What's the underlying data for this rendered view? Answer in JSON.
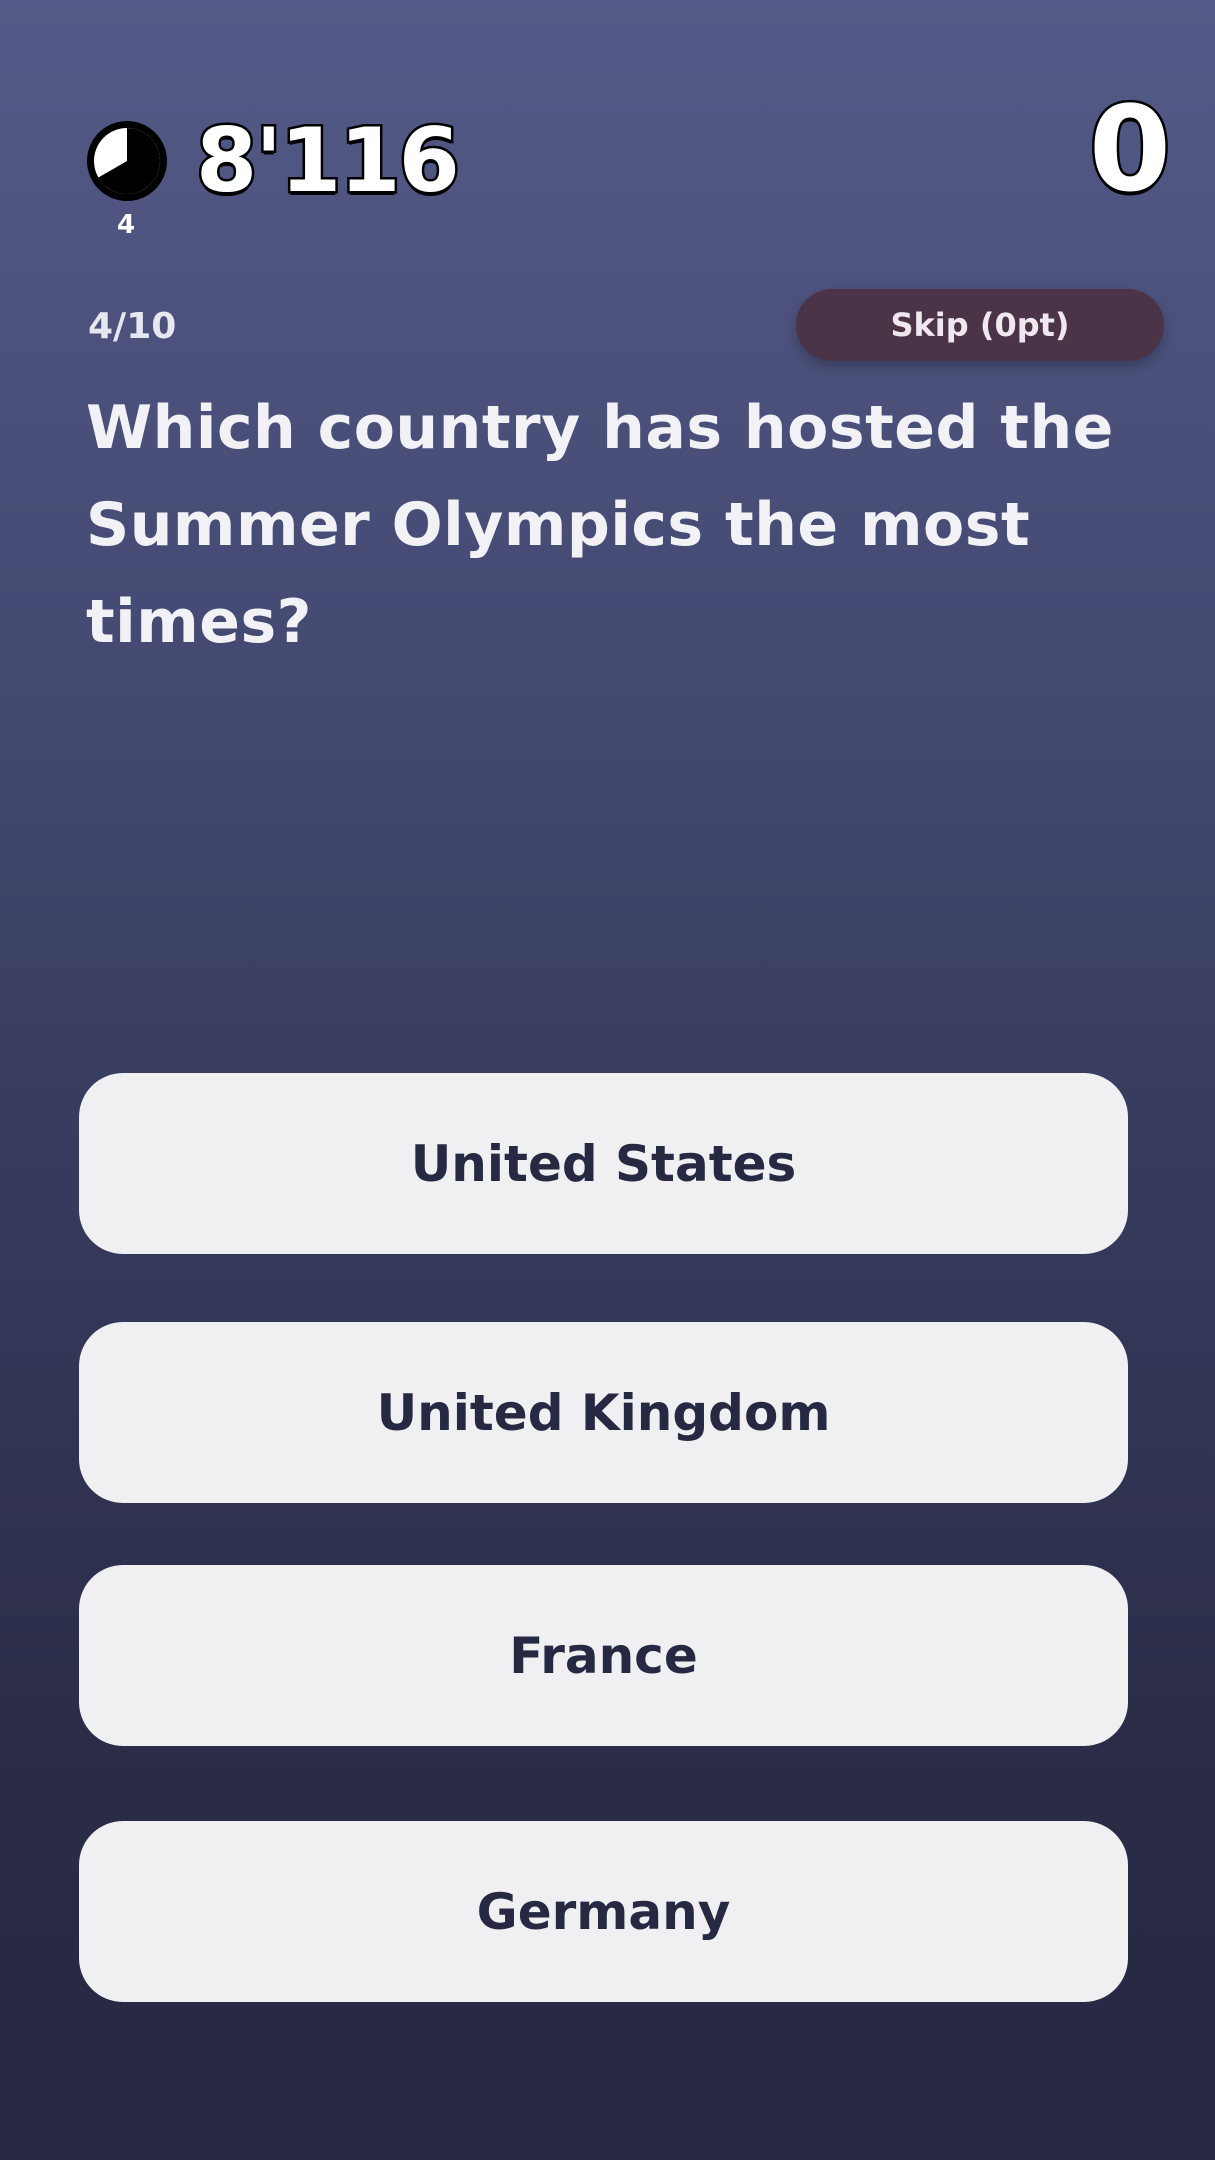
{
  "hud": {
    "timer_icon": "stopwatch-icon",
    "timer_count": "4",
    "time_value": "8'116",
    "score": "0"
  },
  "question": {
    "progress": "4/10",
    "skip_label": "Skip (0pt)",
    "text": "Which country has hosted the Summer Olympics the most times?"
  },
  "answers": [
    {
      "label": "United States"
    },
    {
      "label": "United Kingdom"
    },
    {
      "label": "France"
    },
    {
      "label": "Germany"
    }
  ],
  "colors": {
    "background_top": "#545a87",
    "background_bottom": "#262741",
    "answer_bg": "#f0f0f2",
    "answer_text": "#272942",
    "skip_bg": "#4b3348"
  }
}
